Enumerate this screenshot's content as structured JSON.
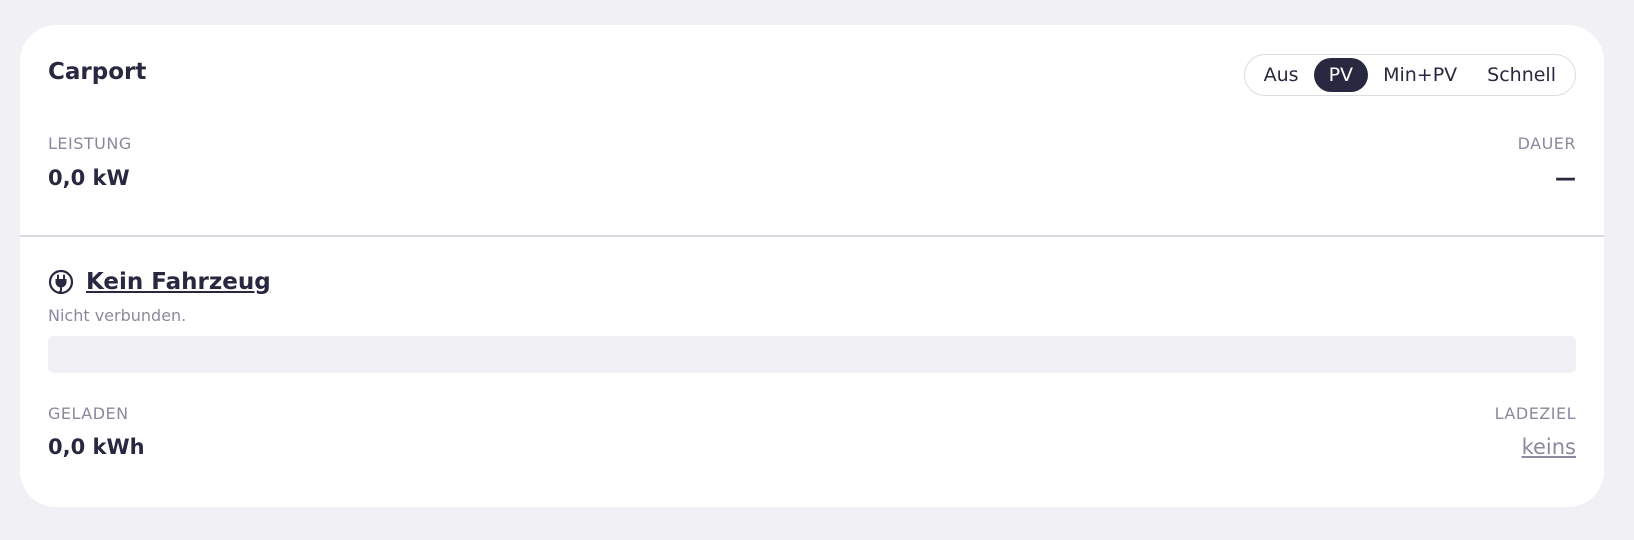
{
  "loadpoint": {
    "title": "Carport",
    "modes": [
      {
        "label": "Aus",
        "active": false
      },
      {
        "label": "PV",
        "active": true
      },
      {
        "label": "Min+PV",
        "active": false
      },
      {
        "label": "Schnell",
        "active": false
      }
    ],
    "power": {
      "label": "LEISTUNG",
      "value": "0,0 kW"
    },
    "duration": {
      "label": "DAUER",
      "value": "—"
    }
  },
  "vehicle": {
    "icon": "plug-icon",
    "title": "Kein Fahrzeug",
    "status": "Nicht verbunden.",
    "progress": 0,
    "charged": {
      "label": "GELADEN",
      "value": "0,0 kWh"
    },
    "target": {
      "label": "LADEZIEL",
      "value": "keins"
    }
  },
  "colors": {
    "background": "#f1f1f5",
    "card": "#ffffff",
    "text": "#282840",
    "muted": "#8a8a9e",
    "active_mode": "#282840"
  }
}
